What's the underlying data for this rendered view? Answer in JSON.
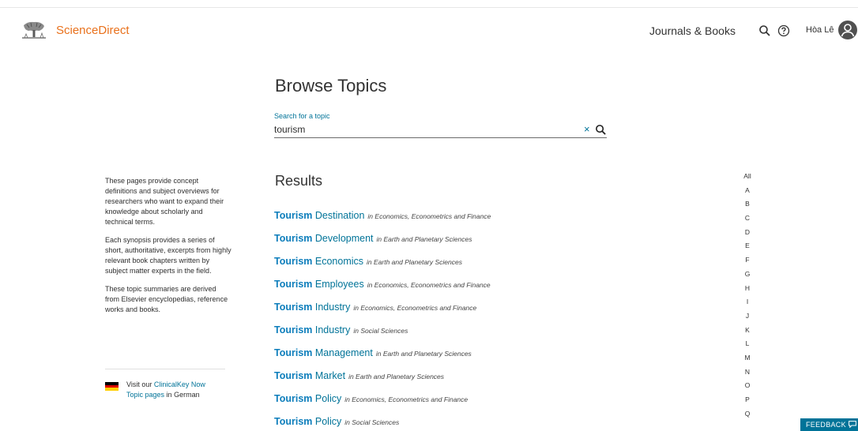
{
  "header": {
    "brand": "ScienceDirect",
    "journals_books": "Journals & Books",
    "user_name": "Hòa Lê"
  },
  "main": {
    "title": "Browse Topics",
    "search": {
      "label": "Search for a topic",
      "value": "tourism",
      "clear_symbol": "×"
    },
    "results_title": "Results",
    "results": [
      {
        "keyword": "Tourism",
        "rest": "Destination",
        "field": "in Economics, Econometrics and Finance"
      },
      {
        "keyword": "Tourism",
        "rest": "Development",
        "field": "in Earth and Planetary Sciences"
      },
      {
        "keyword": "Tourism",
        "rest": "Economics",
        "field": "in Earth and Planetary Sciences"
      },
      {
        "keyword": "Tourism",
        "rest": "Employees",
        "field": "in Economics, Econometrics and Finance"
      },
      {
        "keyword": "Tourism",
        "rest": "Industry",
        "field": "in Economics, Econometrics and Finance"
      },
      {
        "keyword": "Tourism",
        "rest": "Industry",
        "field": "in Social Sciences"
      },
      {
        "keyword": "Tourism",
        "rest": "Management",
        "field": "in Earth and Planetary Sciences"
      },
      {
        "keyword": "Tourism",
        "rest": "Market",
        "field": "in Earth and Planetary Sciences"
      },
      {
        "keyword": "Tourism",
        "rest": "Policy",
        "field": "in Economics, Econometrics and Finance"
      },
      {
        "keyword": "Tourism",
        "rest": "Policy",
        "field": "in Social Sciences"
      }
    ]
  },
  "sidebar": {
    "paragraphs": [
      "These pages provide concept definitions and subject overviews for researchers who want to expand their knowledge about scholarly and technical terms.",
      "Each synopsis provides a series of short, authoritative, excerpts from highly relevant book chapters written by subject matter experts in the field.",
      "These topic summaries are derived from Elsevier encyclopedias, reference works and books."
    ],
    "clinical_prefix": "Visit our",
    "clinical_link": "ClinicalKey Now Topic pages",
    "clinical_suffix": "in German"
  },
  "alphabet": [
    "All",
    "A",
    "B",
    "C",
    "D",
    "E",
    "F",
    "G",
    "H",
    "I",
    "J",
    "K",
    "L",
    "M",
    "N",
    "O",
    "P",
    "Q"
  ],
  "feedback_label": "FEEDBACK",
  "icons": {
    "logo": "elsevier-tree-icon",
    "search": "search-icon",
    "help": "help-circle-icon",
    "avatar": "user-avatar-icon",
    "clear": "close-icon",
    "flag": "german-flag-icon",
    "feedback": "speech-bubble-icon"
  },
  "colors": {
    "brand": "#e9711c",
    "link": "#007398",
    "keyword": "#0c7dbb",
    "feedback_bg": "#007398"
  }
}
